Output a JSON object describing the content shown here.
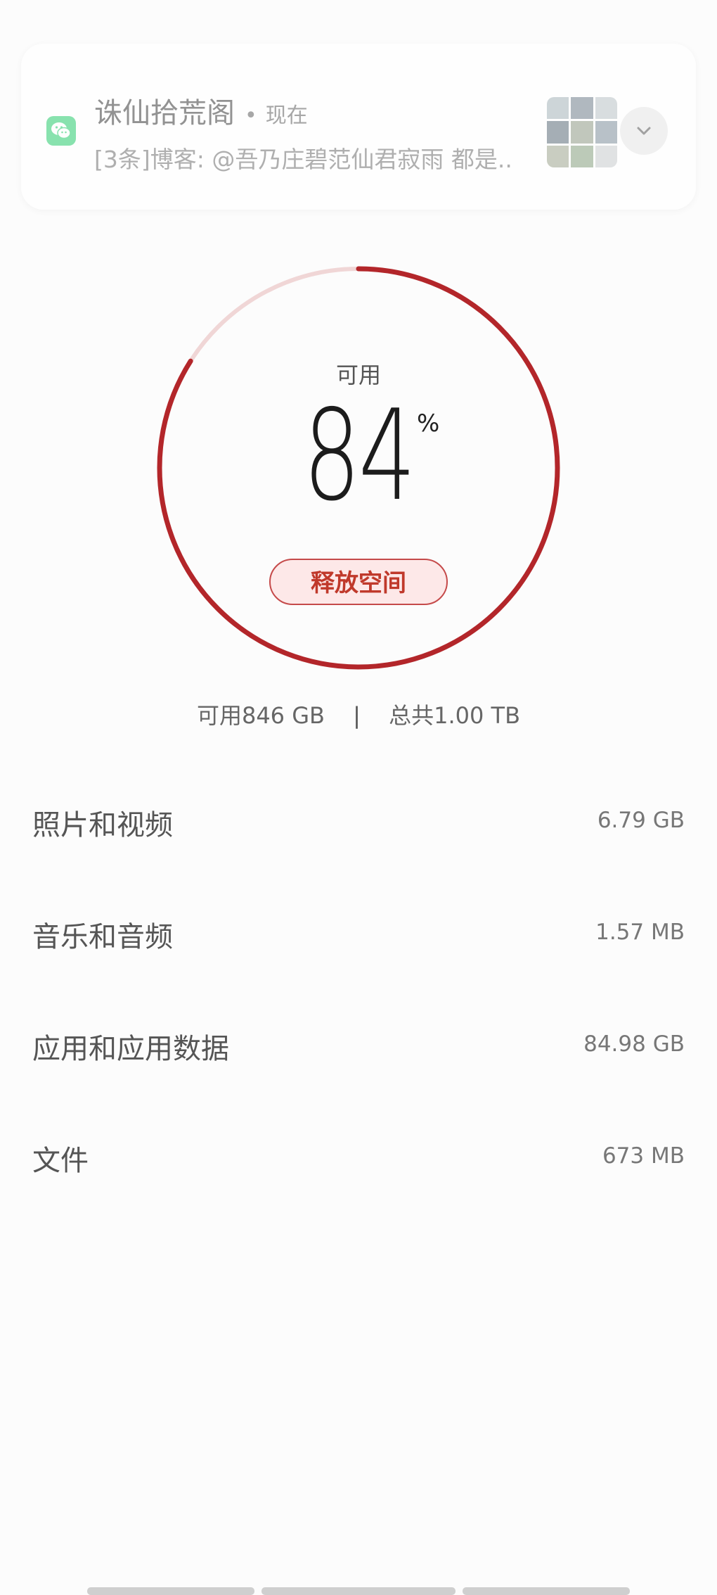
{
  "notification": {
    "app_icon": "wechat-icon",
    "app_title": "诛仙拾荒阁",
    "separator": "•",
    "time": "现在",
    "message": "[3条]博客: @吾乃庄碧范仙君寂雨 都是..",
    "expand_icon": "chevron-down-icon"
  },
  "storage": {
    "available_label": "可用",
    "available_percent": "84",
    "percent_sign": "%",
    "available_fraction": 0.84,
    "release_button": "释放空间",
    "available_text": "可用846 GB",
    "divider": "|",
    "total_text": "总共1.00 TB",
    "accent_color": "#b3262a",
    "track_color": "#f0d6d6"
  },
  "categories": [
    {
      "name": "照片和视频",
      "size": "6.79 GB"
    },
    {
      "name": "音乐和音频",
      "size": "1.57 MB"
    },
    {
      "name": "应用和应用数据",
      "size": "84.98 GB"
    },
    {
      "name": "文件",
      "size": "673 MB"
    }
  ]
}
